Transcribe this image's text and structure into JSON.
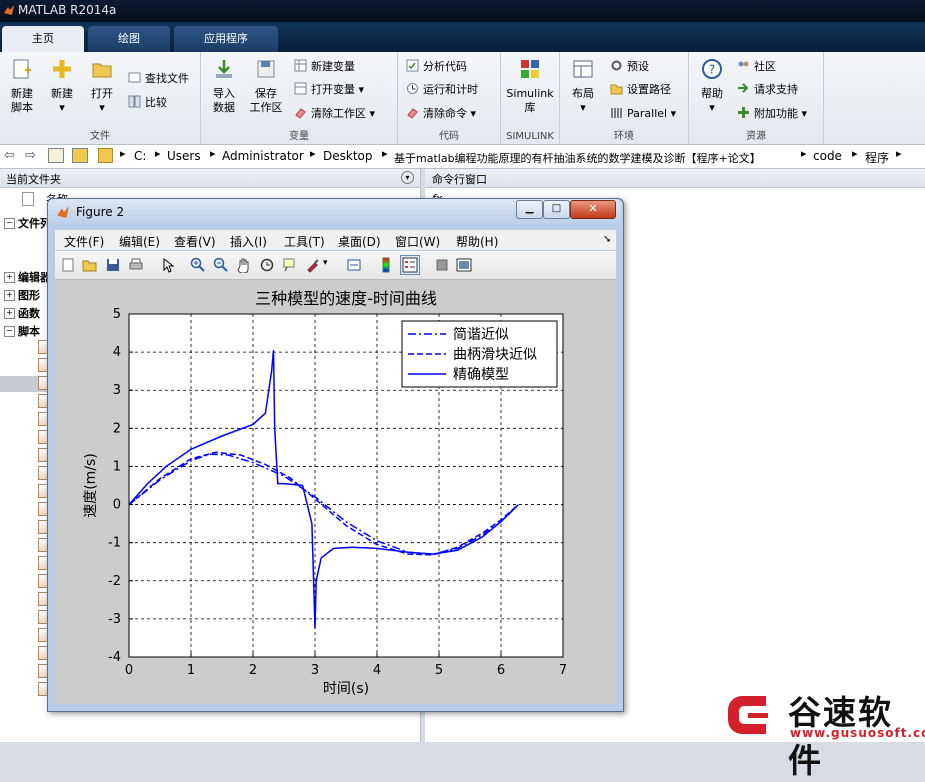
{
  "app": {
    "title": "MATLAB R2014a"
  },
  "tabs": [
    {
      "label": "主页"
    },
    {
      "label": "绘图"
    },
    {
      "label": "应用程序"
    }
  ],
  "ribbon": {
    "file": {
      "caption": "文件",
      "new_script": [
        "新建",
        "脚本"
      ],
      "new": "新建",
      "open": "打开",
      "find_files": "查找文件",
      "compare": "比较"
    },
    "variable": {
      "caption": "变量",
      "import": [
        "导入",
        "数据"
      ],
      "save_ws": [
        "保存",
        "工作区"
      ],
      "new_var": "新建变量",
      "open_var": "打开变量",
      "clear_ws": "清除工作区"
    },
    "code": {
      "caption": "代码",
      "analyze": "分析代码",
      "run_time": "运行和计时",
      "clear_cmd": "清除命令"
    },
    "simulink": {
      "caption": "SIMULINK",
      "label": [
        "Simulink",
        "库"
      ]
    },
    "env": {
      "caption": "环境",
      "layout": "布局",
      "prefs": "预设",
      "set_path": "设置路径",
      "parallel": "Parallel"
    },
    "resources": {
      "caption": "资源",
      "help": "帮助",
      "community": "社区",
      "support": "请求支持",
      "addons": "附加功能"
    }
  },
  "breadcrumb": [
    "C:",
    "Users",
    "Administrator",
    "Desktop",
    "基于matlab编程功能原理的有杆抽油系统的数学建模及诊断【程序+论文】",
    "code",
    "程序"
  ],
  "left_panel": {
    "header": "当前文件夹",
    "name_col": "名称",
    "groups": [
      "文件列表",
      "编辑器",
      "图形",
      "函数",
      "脚本"
    ]
  },
  "right_panel": {
    "header": "命令行窗口",
    "prompt": "fx"
  },
  "figure": {
    "title": "Figure 2",
    "menu": [
      "文件(F)",
      "编辑(E)",
      "查看(V)",
      "插入(I)",
      "工具(T)",
      "桌面(D)",
      "窗口(W)",
      "帮助(H)"
    ]
  },
  "chart_data": {
    "type": "line",
    "title": "三种模型的速度-时间曲线",
    "xlabel": "时间(s)",
    "ylabel": "速度(m/s)",
    "xlim": [
      0,
      7
    ],
    "ylim": [
      -4,
      5
    ],
    "xticks": [
      "0",
      "1",
      "2",
      "3",
      "4",
      "5",
      "6",
      "7"
    ],
    "yticks": [
      "-4",
      "-3",
      "-2",
      "-1",
      "0",
      "1",
      "2",
      "3",
      "4",
      "5"
    ],
    "grid": true,
    "legend_position": "top-right",
    "line_color": "#0000ff",
    "series": [
      {
        "name": "简谐近似",
        "style": "dash-dot",
        "x": [
          0,
          0.5,
          1.0,
          1.3,
          1.6,
          2.0,
          2.5,
          3.0,
          3.5,
          4.0,
          4.5,
          4.9,
          5.3,
          5.7,
          6.0,
          6.28
        ],
        "y": [
          0,
          0.65,
          1.15,
          1.32,
          1.3,
          1.1,
          0.75,
          0.2,
          -0.45,
          -0.95,
          -1.25,
          -1.3,
          -1.15,
          -0.8,
          -0.45,
          0
        ]
      },
      {
        "name": "曲柄滑块近似",
        "style": "dashed",
        "x": [
          0,
          0.5,
          1.0,
          1.4,
          1.8,
          2.2,
          2.6,
          3.0,
          3.5,
          4.0,
          4.5,
          4.9,
          5.3,
          5.7,
          6.0,
          6.28
        ],
        "y": [
          0,
          0.68,
          1.2,
          1.37,
          1.3,
          1.05,
          0.7,
          0.15,
          -0.55,
          -1.05,
          -1.3,
          -1.32,
          -1.12,
          -0.75,
          -0.4,
          0
        ]
      },
      {
        "name": "精确模型",
        "style": "solid",
        "x": [
          0,
          0.3,
          0.6,
          1.0,
          1.5,
          2.0,
          2.2,
          2.3,
          2.33,
          2.35,
          2.4,
          2.5,
          2.8,
          2.95,
          3.0,
          3.02,
          3.1,
          3.3,
          3.6,
          4.0,
          4.5,
          4.9,
          5.3,
          5.7,
          6.0,
          6.28
        ],
        "y": [
          0,
          0.55,
          1.0,
          1.45,
          1.8,
          2.1,
          2.4,
          3.5,
          4.05,
          2.0,
          0.55,
          0.55,
          0.5,
          -0.5,
          -3.25,
          -2.0,
          -1.4,
          -1.15,
          -1.12,
          -1.15,
          -1.25,
          -1.3,
          -1.2,
          -0.85,
          -0.45,
          0
        ]
      }
    ]
  },
  "watermark": {
    "brand": "谷速软件",
    "url": "www.gusuosoft.com",
    "color": "#d4202a"
  }
}
